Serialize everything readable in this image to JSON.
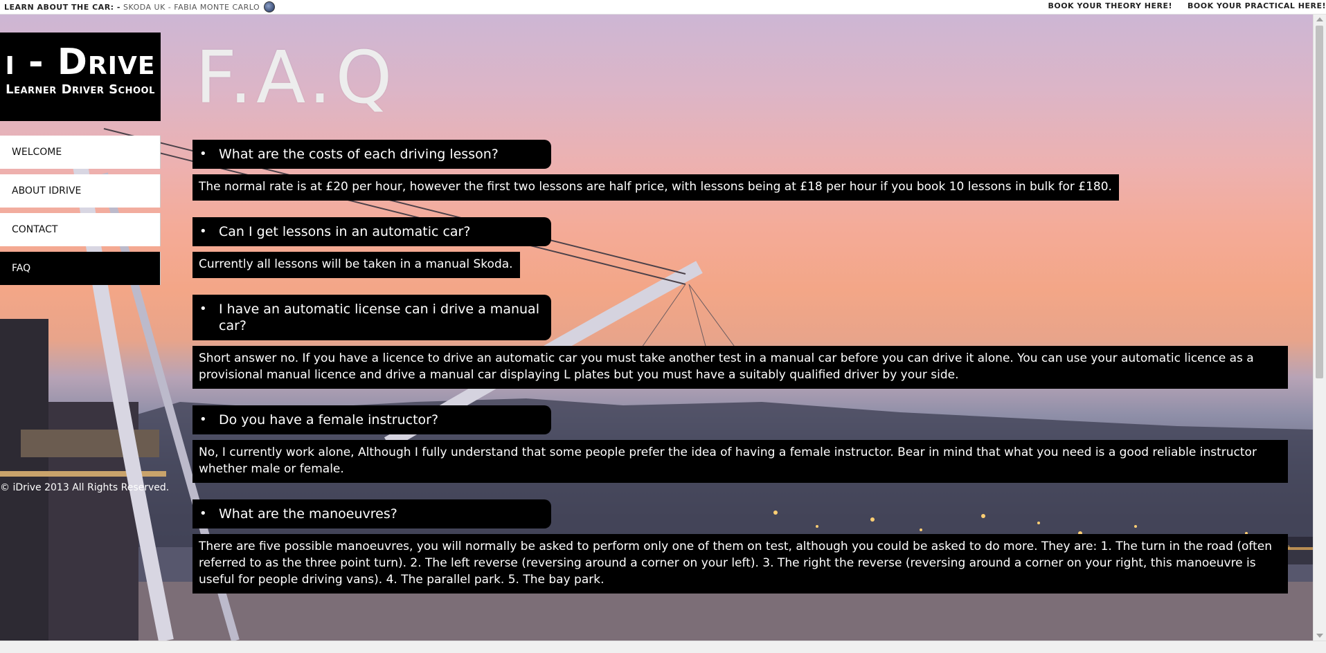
{
  "topbar": {
    "lead": "LEARN ABOUT THE CAR: -",
    "link": "SKODA UK - FABIA MONTE CARLO",
    "badge_icon": "skoda-logo-icon",
    "theory_link": "BOOK YOUR THEORY HERE!",
    "practical_link": "BOOK YOUR PRACTICAL HERE!"
  },
  "logo": {
    "title": "i - Drive",
    "subtitle": "Learner Driver School"
  },
  "nav": {
    "items": [
      {
        "label": "WELCOME"
      },
      {
        "label": "ABOUT IDRIVE"
      },
      {
        "label": "CONTACT"
      },
      {
        "label": "FAQ"
      }
    ]
  },
  "page": {
    "title": "F.A.Q",
    "copyright": "© iDrive 2013 All Rights Reserved."
  },
  "faq": [
    {
      "question": "What are the costs of each driving lesson?",
      "answer": "The normal rate is at £20 per hour, however the first two lessons are half price, with lessons being at £18 per hour if you book 10 lessons in bulk for £180."
    },
    {
      "question": "Can I get lessons in an automatic car?",
      "answer": "Currently all lessons will be taken in a manual Skoda."
    },
    {
      "question": "I have an automatic license can i drive a manual car?",
      "answer": "Short answer no. If you have a licence to drive an automatic car you must take another test in a manual car before you can drive it alone. You can use your automatic licence as a provisional manual licence and drive a manual car displaying L plates but you must have a suitably qualified driver by your side."
    },
    {
      "question": "Do you have a female instructor?",
      "answer": "No, I currently work alone, Although I fully understand that some people prefer the idea of having a female instructor. Bear in mind that what you need is a good reliable instructor whether male or female."
    },
    {
      "question": "What are the manoeuvres?",
      "answer": "There are five possible manoeuvres, you will normally be asked to perform only one of them on test, although you could be asked to do more. They are: 1. The turn in the road (often referred to as the three point turn). 2. The left reverse (reversing around a corner on your left). 3. The right the reverse (reversing around a corner on your right, this manoeuvre is useful for people driving vans). 4. The parallel park. 5. The bay park."
    }
  ],
  "colors": {
    "panel": "#000000",
    "panel_text": "#ffffff",
    "nav_bg": "#ffffff",
    "nav_active_bg": "#000000",
    "title_text": "#ededed"
  }
}
